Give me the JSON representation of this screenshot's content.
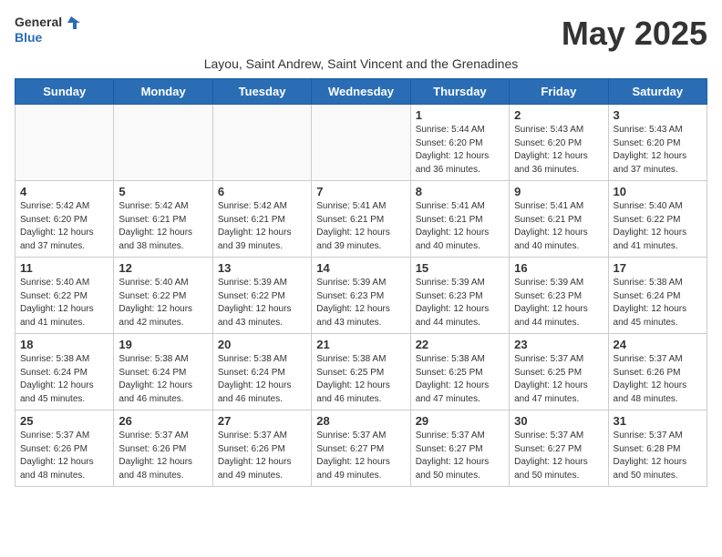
{
  "logo": {
    "general": "General",
    "blue": "Blue"
  },
  "title": "May 2025",
  "subtitle": "Layou, Saint Andrew, Saint Vincent and the Grenadines",
  "days_of_week": [
    "Sunday",
    "Monday",
    "Tuesday",
    "Wednesday",
    "Thursday",
    "Friday",
    "Saturday"
  ],
  "weeks": [
    [
      {
        "day": "",
        "info": ""
      },
      {
        "day": "",
        "info": ""
      },
      {
        "day": "",
        "info": ""
      },
      {
        "day": "",
        "info": ""
      },
      {
        "day": "1",
        "info": "Sunrise: 5:44 AM\nSunset: 6:20 PM\nDaylight: 12 hours and 36 minutes."
      },
      {
        "day": "2",
        "info": "Sunrise: 5:43 AM\nSunset: 6:20 PM\nDaylight: 12 hours and 36 minutes."
      },
      {
        "day": "3",
        "info": "Sunrise: 5:43 AM\nSunset: 6:20 PM\nDaylight: 12 hours and 37 minutes."
      }
    ],
    [
      {
        "day": "4",
        "info": "Sunrise: 5:42 AM\nSunset: 6:20 PM\nDaylight: 12 hours and 37 minutes."
      },
      {
        "day": "5",
        "info": "Sunrise: 5:42 AM\nSunset: 6:21 PM\nDaylight: 12 hours and 38 minutes."
      },
      {
        "day": "6",
        "info": "Sunrise: 5:42 AM\nSunset: 6:21 PM\nDaylight: 12 hours and 39 minutes."
      },
      {
        "day": "7",
        "info": "Sunrise: 5:41 AM\nSunset: 6:21 PM\nDaylight: 12 hours and 39 minutes."
      },
      {
        "day": "8",
        "info": "Sunrise: 5:41 AM\nSunset: 6:21 PM\nDaylight: 12 hours and 40 minutes."
      },
      {
        "day": "9",
        "info": "Sunrise: 5:41 AM\nSunset: 6:21 PM\nDaylight: 12 hours and 40 minutes."
      },
      {
        "day": "10",
        "info": "Sunrise: 5:40 AM\nSunset: 6:22 PM\nDaylight: 12 hours and 41 minutes."
      }
    ],
    [
      {
        "day": "11",
        "info": "Sunrise: 5:40 AM\nSunset: 6:22 PM\nDaylight: 12 hours and 41 minutes."
      },
      {
        "day": "12",
        "info": "Sunrise: 5:40 AM\nSunset: 6:22 PM\nDaylight: 12 hours and 42 minutes."
      },
      {
        "day": "13",
        "info": "Sunrise: 5:39 AM\nSunset: 6:22 PM\nDaylight: 12 hours and 43 minutes."
      },
      {
        "day": "14",
        "info": "Sunrise: 5:39 AM\nSunset: 6:23 PM\nDaylight: 12 hours and 43 minutes."
      },
      {
        "day": "15",
        "info": "Sunrise: 5:39 AM\nSunset: 6:23 PM\nDaylight: 12 hours and 44 minutes."
      },
      {
        "day": "16",
        "info": "Sunrise: 5:39 AM\nSunset: 6:23 PM\nDaylight: 12 hours and 44 minutes."
      },
      {
        "day": "17",
        "info": "Sunrise: 5:38 AM\nSunset: 6:24 PM\nDaylight: 12 hours and 45 minutes."
      }
    ],
    [
      {
        "day": "18",
        "info": "Sunrise: 5:38 AM\nSunset: 6:24 PM\nDaylight: 12 hours and 45 minutes."
      },
      {
        "day": "19",
        "info": "Sunrise: 5:38 AM\nSunset: 6:24 PM\nDaylight: 12 hours and 46 minutes."
      },
      {
        "day": "20",
        "info": "Sunrise: 5:38 AM\nSunset: 6:24 PM\nDaylight: 12 hours and 46 minutes."
      },
      {
        "day": "21",
        "info": "Sunrise: 5:38 AM\nSunset: 6:25 PM\nDaylight: 12 hours and 46 minutes."
      },
      {
        "day": "22",
        "info": "Sunrise: 5:38 AM\nSunset: 6:25 PM\nDaylight: 12 hours and 47 minutes."
      },
      {
        "day": "23",
        "info": "Sunrise: 5:37 AM\nSunset: 6:25 PM\nDaylight: 12 hours and 47 minutes."
      },
      {
        "day": "24",
        "info": "Sunrise: 5:37 AM\nSunset: 6:26 PM\nDaylight: 12 hours and 48 minutes."
      }
    ],
    [
      {
        "day": "25",
        "info": "Sunrise: 5:37 AM\nSunset: 6:26 PM\nDaylight: 12 hours and 48 minutes."
      },
      {
        "day": "26",
        "info": "Sunrise: 5:37 AM\nSunset: 6:26 PM\nDaylight: 12 hours and 48 minutes."
      },
      {
        "day": "27",
        "info": "Sunrise: 5:37 AM\nSunset: 6:26 PM\nDaylight: 12 hours and 49 minutes."
      },
      {
        "day": "28",
        "info": "Sunrise: 5:37 AM\nSunset: 6:27 PM\nDaylight: 12 hours and 49 minutes."
      },
      {
        "day": "29",
        "info": "Sunrise: 5:37 AM\nSunset: 6:27 PM\nDaylight: 12 hours and 50 minutes."
      },
      {
        "day": "30",
        "info": "Sunrise: 5:37 AM\nSunset: 6:27 PM\nDaylight: 12 hours and 50 minutes."
      },
      {
        "day": "31",
        "info": "Sunrise: 5:37 AM\nSunset: 6:28 PM\nDaylight: 12 hours and 50 minutes."
      }
    ]
  ]
}
